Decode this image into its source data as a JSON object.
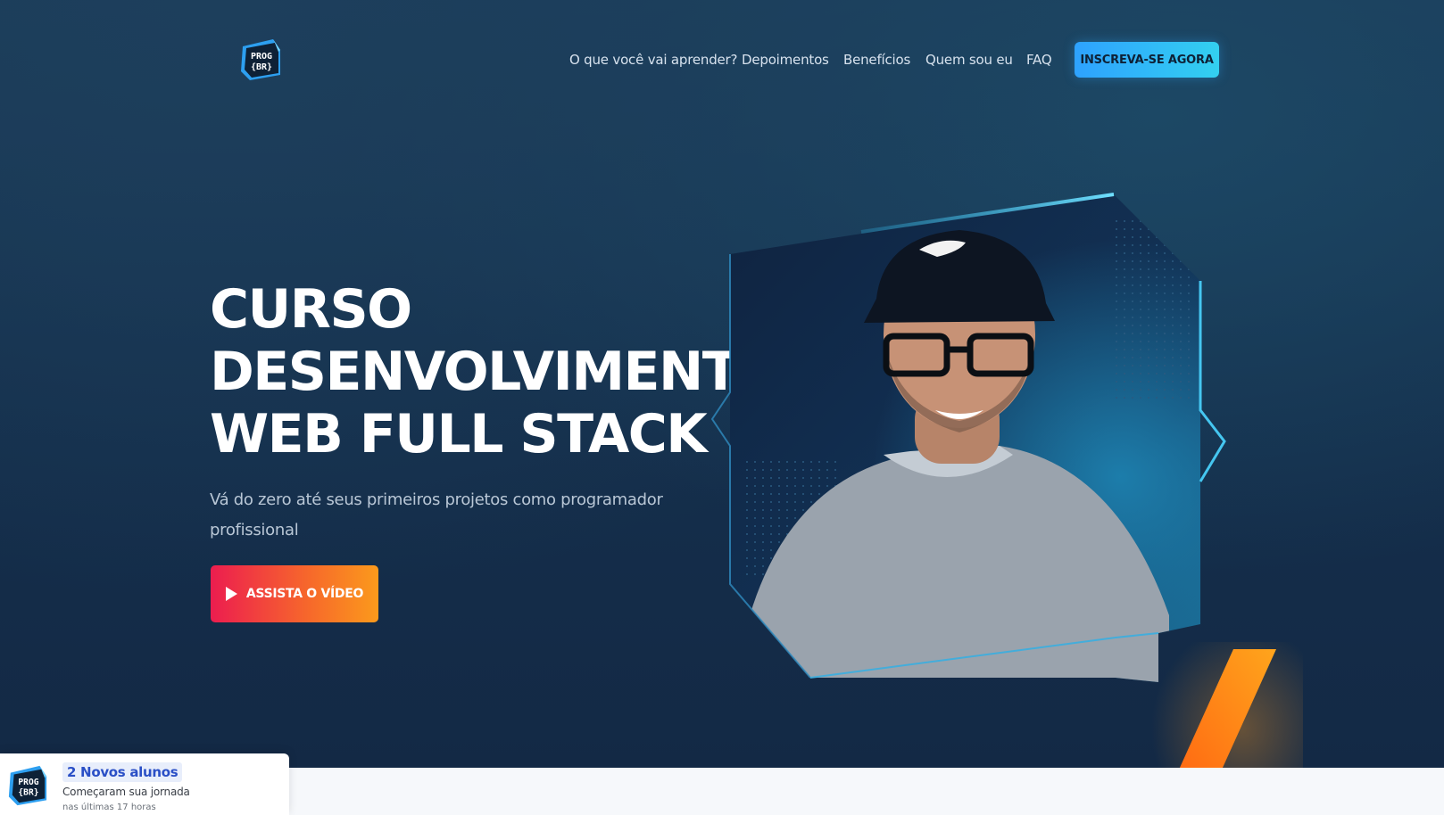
{
  "header": {
    "logo_top": "PROG",
    "logo_bottom": "{BR}",
    "nav": [
      {
        "label": "O que você vai aprender?"
      },
      {
        "label": "Depoimentos"
      },
      {
        "label": "Benefícios"
      },
      {
        "label": "Quem sou eu"
      },
      {
        "label": "FAQ"
      }
    ],
    "cta_label": "INSCREVA-SE AGORA"
  },
  "hero": {
    "title_lines": [
      "CURSO",
      "DESENVOLVIMENTO",
      "WEB FULL STACK"
    ],
    "subtitle": "Vá do zero até seus primeiros projetos como programador profissional",
    "video_button_label": "ASSISTA O VÍDEO",
    "play_icon": "play-icon"
  },
  "toast": {
    "title": "2 Novos alunos",
    "line": "Começaram sua jornada",
    "time": "nas últimas 17 horas"
  },
  "colors": {
    "background": "#15304d",
    "accent_blue": "#2ea2ff",
    "accent_orange": "#fb9a1c",
    "accent_red": "#ec1d4f"
  }
}
